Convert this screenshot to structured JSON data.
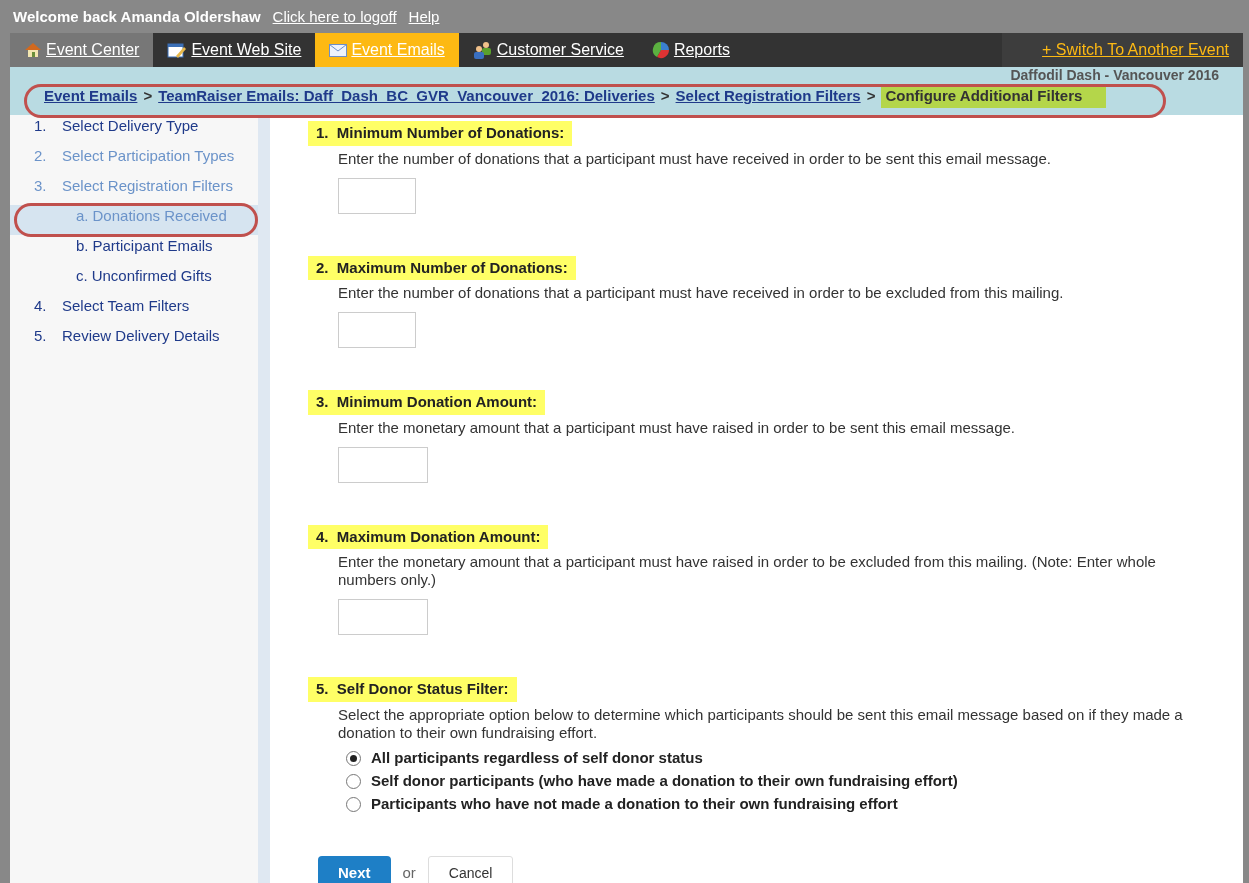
{
  "header": {
    "welcome": "Welcome back Amanda Oldershaw",
    "links": [
      "Click here to logoff",
      "Help"
    ]
  },
  "nav": {
    "tabs": [
      {
        "label": "Event Center",
        "selected": false
      },
      {
        "label": "Event Web Site",
        "selected": false
      },
      {
        "label": "Event Emails",
        "selected": true
      },
      {
        "label": "Customer Service",
        "selected": false
      },
      {
        "label": "Reports",
        "selected": false
      }
    ],
    "switch_link": "+ Switch To Another Event"
  },
  "event_name": "Daffodil Dash - Vancouver 2016",
  "breadcrumb": [
    {
      "label": "Event Emails",
      "current": false
    },
    {
      "label": "TeamRaiser Emails: Daff_Dash_BC_GVR_Vancouver_2016: Deliveries",
      "current": false
    },
    {
      "label": "Select Registration Filters",
      "current": false
    },
    {
      "label": "Configure Additional Filters",
      "current": true
    }
  ],
  "breadcrumb_separator": ">",
  "steps": [
    {
      "number": "1.",
      "label": "Select Delivery Type",
      "active": false,
      "selected": false
    },
    {
      "number": "2.",
      "label": "Select Participation Types",
      "active": true,
      "selected": false
    },
    {
      "number": "3.",
      "label": "Select Registration Filters",
      "active": true,
      "selected": false,
      "children": [
        {
          "number": "a.",
          "label": "Donations Received",
          "active": true,
          "selected": true
        },
        {
          "number": "b.",
          "label": "Participant Emails",
          "active": false,
          "selected": false
        },
        {
          "number": "c.",
          "label": "Unconfirmed Gifts",
          "active": false,
          "selected": false
        }
      ]
    },
    {
      "number": "4.",
      "label": "Select Team Filters",
      "active": false,
      "selected": false
    },
    {
      "number": "5.",
      "label": "Review Delivery Details",
      "active": false,
      "selected": false
    }
  ],
  "sections": [
    {
      "kind": "input",
      "number": "1.",
      "title": "Minimum Number of Donations:",
      "description": "Enter the number of donations that a participant must have received in order to be sent this email message."
    },
    {
      "kind": "input",
      "number": "2.",
      "title": "Maximum Number of Donations:",
      "description": "Enter the number of donations that a participant must have received in order to be excluded from this mailing."
    },
    {
      "kind": "input",
      "number": "3.",
      "title": "Minimum Donation Amount:",
      "description": "Enter the monetary amount that a participant must have raised in order to be sent this email message."
    },
    {
      "kind": "input",
      "number": "4.",
      "title": "Maximum Donation Amount:",
      "description": "Enter the monetary amount that a participant must have raised in order to be excluded from this mailing. (Note: Enter whole numbers only.)"
    },
    {
      "kind": "radio",
      "number": "5.",
      "title": "Self Donor Status Filter:",
      "description": "Select the appropriate option below to determine which participants should be sent this email message based on if they made a donation to their own fundraising effort.",
      "options": [
        {
          "label": "All participants regardless of self donor status",
          "selected": true
        },
        {
          "label": "Self donor participants (who have made a donation to their own fundraising effort)",
          "selected": false
        },
        {
          "label": "Participants who have not made a donation to their own fundraising effort",
          "selected": false
        }
      ]
    }
  ],
  "actions": {
    "primary": "Next",
    "separator": "or",
    "secondary": "Cancel"
  }
}
